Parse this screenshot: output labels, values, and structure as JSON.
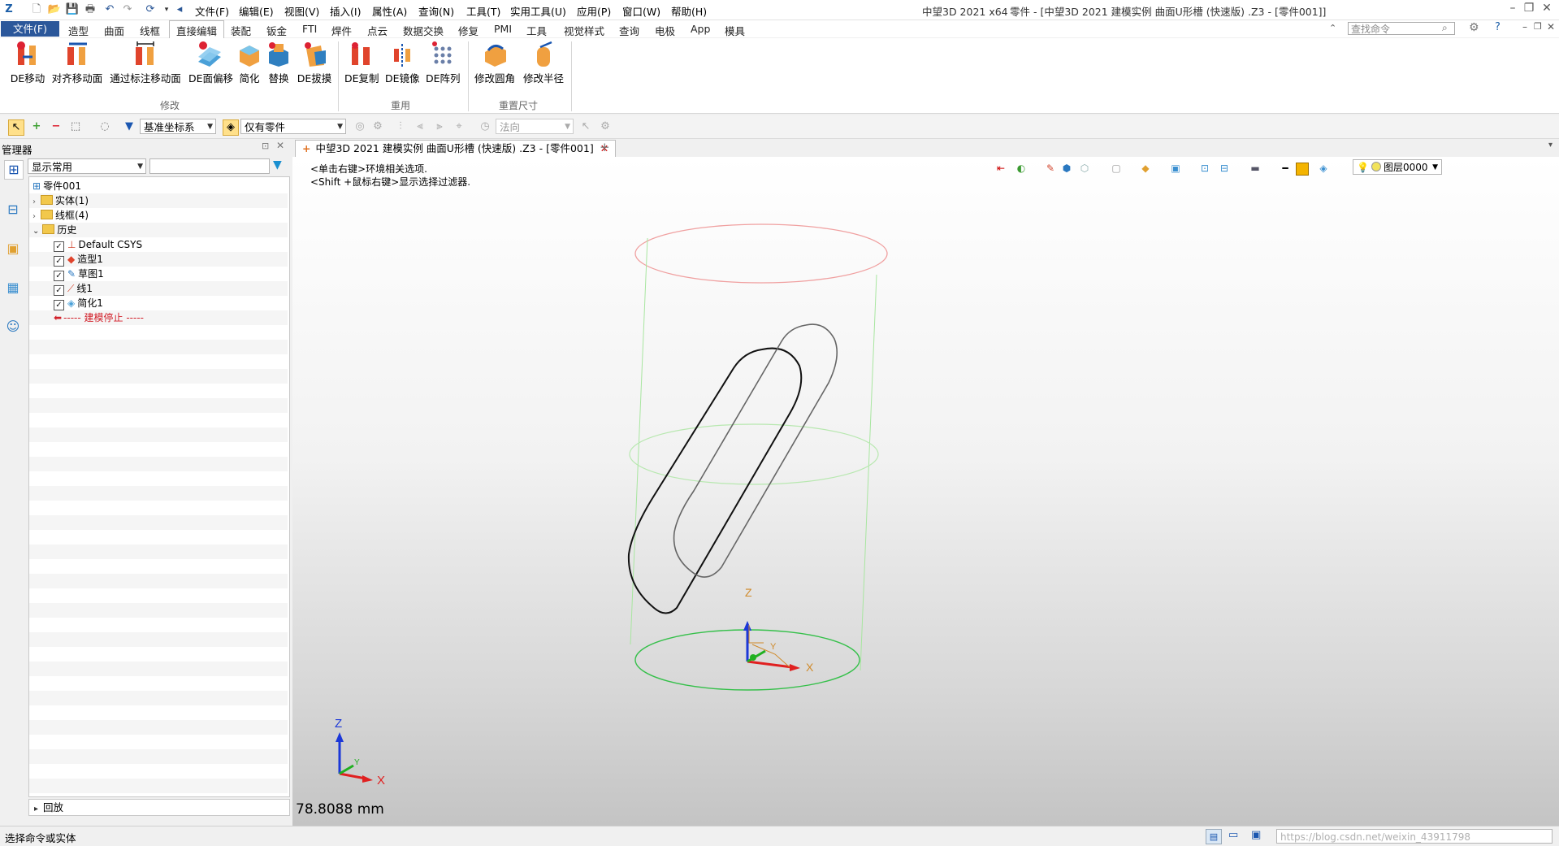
{
  "titlebar": {
    "app_name": "中望3D 2021 x64",
    "window_title": "零件 - [中望3D 2021 建模实例 曲面U形槽 (快速版) .Z3 - [零件001]]",
    "menus": [
      "文件(F)",
      "编辑(E)",
      "视图(V)",
      "插入(I)",
      "属性(A)",
      "查询(N)",
      "工具(T)",
      "实用工具(U)",
      "应用(P)",
      "窗口(W)",
      "帮助(H)"
    ]
  },
  "ribbon_tabs": {
    "file": "文件(F)",
    "tabs": [
      "造型",
      "曲面",
      "线框",
      "直接编辑",
      "装配",
      "钣金",
      "FTI",
      "焊件",
      "点云",
      "数据交换",
      "修复",
      "PMI",
      "工具",
      "视觉样式",
      "查询",
      "电极",
      "App",
      "模具"
    ],
    "active": "直接编辑",
    "search_placeholder": "查找命令"
  },
  "ribbon": {
    "groups": {
      "modify": "修改",
      "reuse": "重用",
      "resize": "重置尺寸"
    },
    "buttons": [
      "DE移动",
      "对齐移动面",
      "通过标注移动面",
      "DE面偏移",
      "简化",
      "替换",
      "DE拔摸",
      "DE复制",
      "DE镜像",
      "DE阵列",
      "修改圆角",
      "修改半径"
    ]
  },
  "toolbar": {
    "csys": "基准坐标系",
    "filter": "仅有零件",
    "direction": "法向"
  },
  "manager": {
    "title": "管理器",
    "display_combo": "显示常用",
    "tree": {
      "root": "零件001",
      "solid": "实体(1)",
      "wireframe": "线框(4)",
      "history": "历史",
      "items": [
        "Default CSYS",
        "造型1",
        "草图1",
        "线1",
        "简化1"
      ],
      "stop": "----- 建模停止 -----"
    },
    "playback": "回放"
  },
  "document": {
    "tab": "中望3D 2021 建模实例 曲面U形槽 (快速版) .Z3 - [零件001]",
    "hint1": "<单击右键>环境相关选项.",
    "hint2": "<Shift +鼠标右键>显示选择过滤器.",
    "layer": "图层0000",
    "measurement": "78.8088 mm"
  },
  "axes": {
    "x": "X",
    "y": "Y",
    "z": "Z"
  },
  "status": {
    "text": "选择命令或实体",
    "watermark": "https://blog.csdn.net/weixin_43911798"
  }
}
